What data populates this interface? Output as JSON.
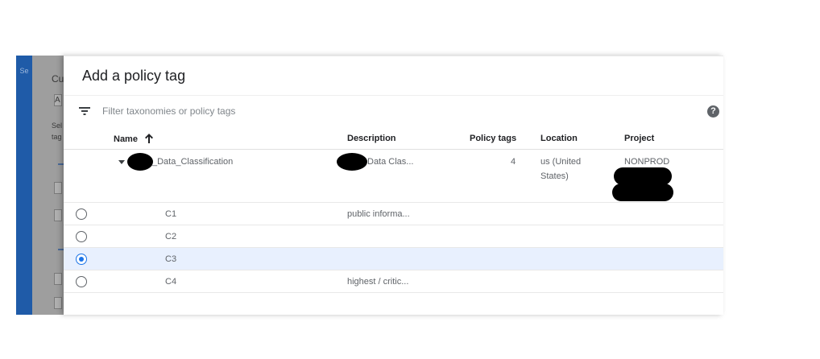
{
  "background": {
    "nav_fragment": "Se",
    "panel_fragments": [
      "Cu",
      "A",
      "Sel",
      "tag"
    ]
  },
  "dialog": {
    "title": "Add a policy tag",
    "filter": {
      "placeholder": "Filter taxonomies or policy tags"
    },
    "help_icon": "?",
    "columns": {
      "name": "Name",
      "description": "Description",
      "policy_tags": "Policy tags",
      "location": "Location",
      "project": "Project"
    },
    "taxonomy": {
      "name": "_Data_Classification",
      "description": "Data Clas...",
      "policy_tags": "4",
      "location_line1": "us (United",
      "location_line2": "States)",
      "project": "NONPROD"
    },
    "tags": [
      {
        "name": "C1",
        "description": "public informa...",
        "selected": false
      },
      {
        "name": "C2",
        "description": "",
        "selected": false
      },
      {
        "name": "C3",
        "description": "",
        "selected": true
      },
      {
        "name": "C4",
        "description": "highest / critic...",
        "selected": false
      }
    ],
    "colors": {
      "accent": "#1a73e8",
      "selected_row": "#e8f0fe"
    }
  }
}
